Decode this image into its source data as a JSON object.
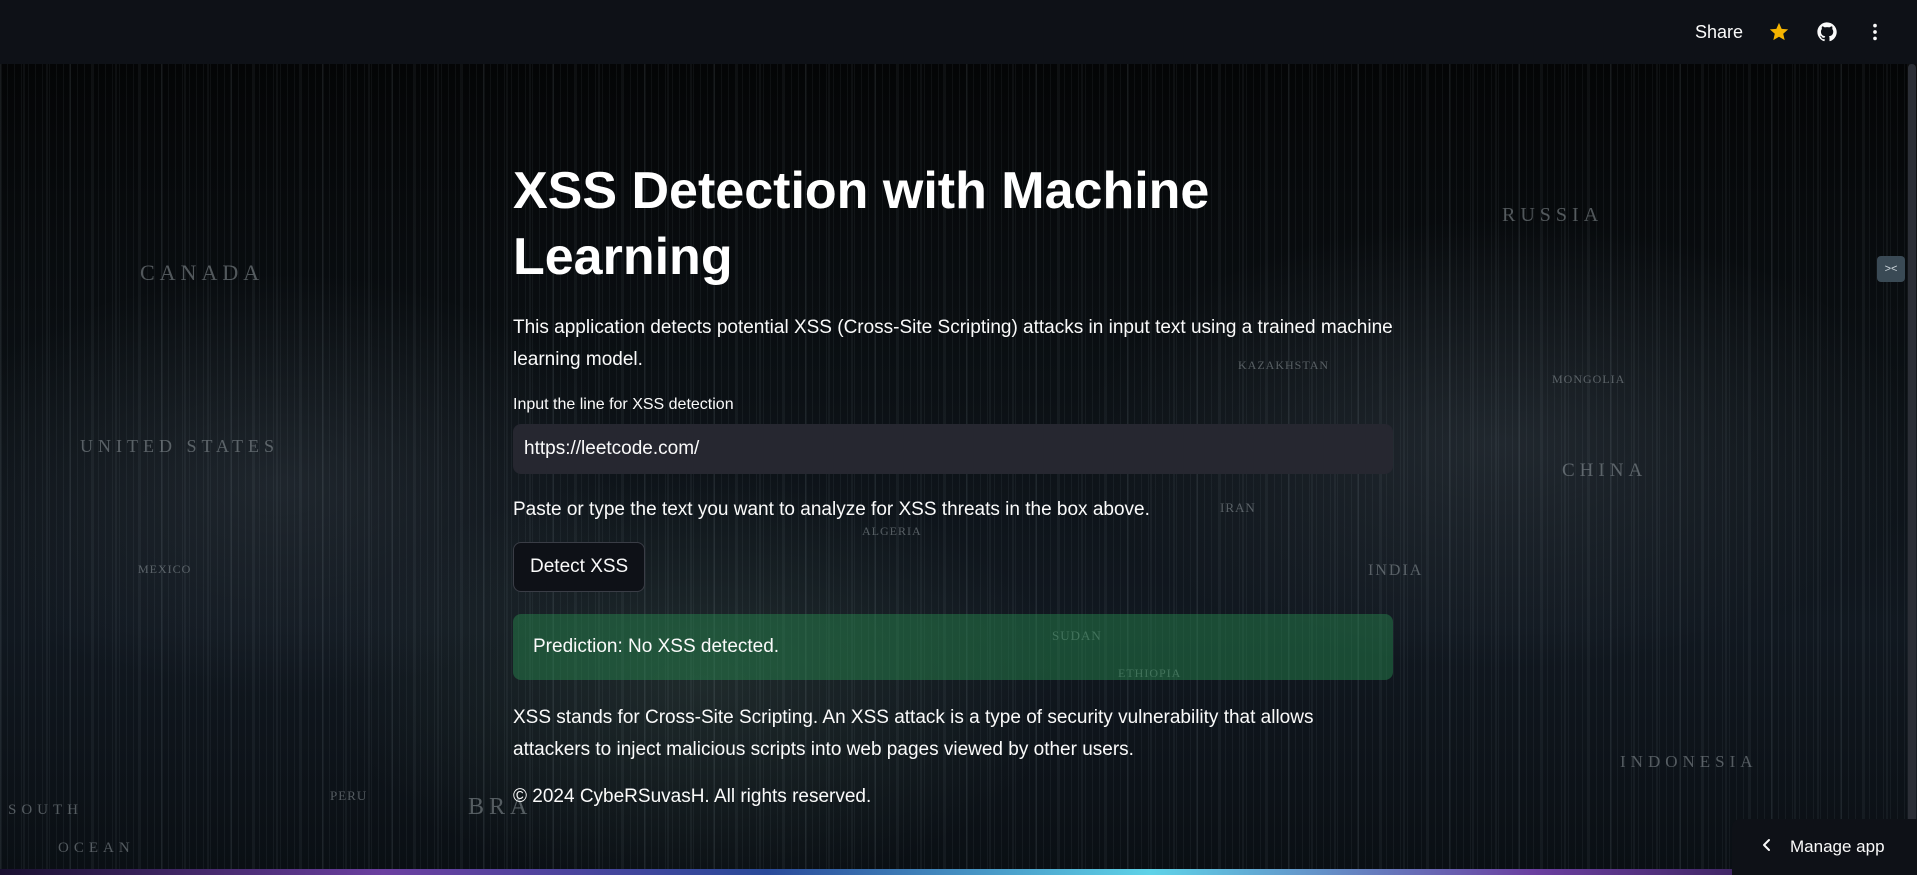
{
  "header": {
    "share_label": "Share",
    "icons": [
      "star-icon",
      "github-icon",
      "more-vertical-icon"
    ],
    "star_color": "#f5b400"
  },
  "map_labels": [
    "CANADA",
    "UNITED STATES",
    "RUSSIA",
    "CHINA",
    "MONGOLIA",
    "KAZAKHSTAN",
    "IRAN",
    "INDIA",
    "INDONESIA",
    "SUDAN",
    "ETHIOPIA",
    "ALGERIA",
    "MEXICO",
    "PERU",
    "BRA",
    "SOUTH",
    "OCEAN"
  ],
  "main": {
    "title": "XSS Detection with Machine Learning",
    "description": "This application detects potential XSS (Cross-Site Scripting) attacks in input text using a trained machine learning model.",
    "input_label": "Input the line for XSS detection",
    "input_value": "https://leetcode.com/",
    "hint": "Paste or type the text you want to analyze for XSS threats in the box above.",
    "button_label": "Detect XSS",
    "prediction": "Prediction: No XSS detected.",
    "explanation": "XSS stands for Cross-Site Scripting. An XSS attack is a type of security vulnerability that allows attackers to inject malicious scripts into web pages viewed by other users.",
    "footer": "© 2024 CybeRSuvasH. All rights reserved."
  },
  "side_tag": "><",
  "manage_app": {
    "label": "Manage app",
    "icon": "chevron-left-icon"
  },
  "colors": {
    "header_bg": "#0e1117",
    "input_bg": "#262730",
    "success_bg": "#288c50"
  }
}
